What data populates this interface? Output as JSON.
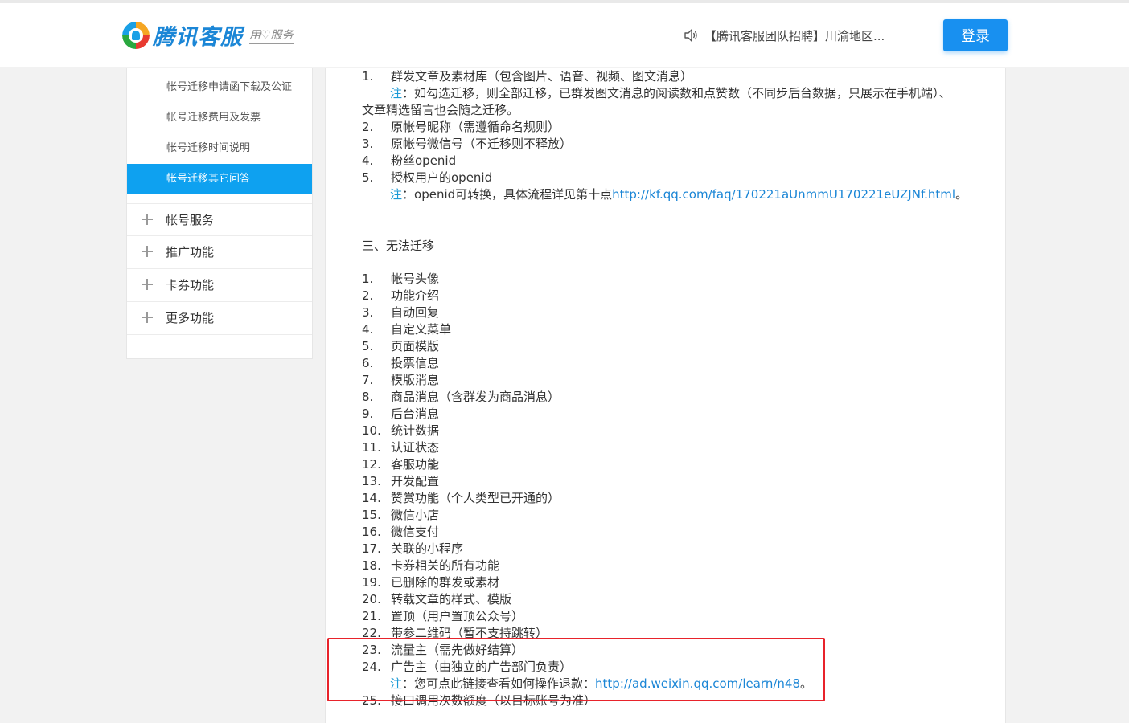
{
  "header": {
    "logo_text": "腾讯客服",
    "logo_slogan": "用♡服务",
    "notice": "【腾讯客服团队招聘】川渝地区...",
    "login_label": "登录"
  },
  "sidebar": {
    "sub_items": [
      {
        "label": "帐号迁移申请函下载及公证",
        "active": false
      },
      {
        "label": "帐号迁移费用及发票",
        "active": false
      },
      {
        "label": "帐号迁移时间说明",
        "active": false
      },
      {
        "label": "帐号迁移其它问答",
        "active": true
      }
    ],
    "categories": [
      {
        "label": "帐号服务"
      },
      {
        "label": "推广功能"
      },
      {
        "label": "卡券功能"
      },
      {
        "label": "更多功能"
      }
    ]
  },
  "content": {
    "migratable": [
      {
        "num": "1.",
        "text": "群发文章及素材库（包含图片、语音、视频、图文消息）"
      },
      {
        "num": "2.",
        "text": "原帐号昵称（需遵循命名规则）"
      },
      {
        "num": "3.",
        "text": "原帐号微信号（不迁移则不释放）"
      },
      {
        "num": "4.",
        "text": "粉丝openid"
      },
      {
        "num": "5.",
        "text": "授权用户的openid"
      }
    ],
    "note1_label": "注",
    "note1_line1": "：如勾选迁移，则全部迁移，已群发图文消息的阅读数和点赞数（不同步后台数据，只展示在手机端）、",
    "note1_line2": "文章精选留言也会随之迁移。",
    "note2_label": "注",
    "note2_text": "：openid可转换，具体流程详见第十点",
    "note2_link": "http://kf.qq.com/faq/170221aUnmmU170221eUZJNf.html",
    "note2_tail": "。",
    "section_title": "三、无法迁移",
    "non_migratable": [
      {
        "num": "1.",
        "text": "帐号头像"
      },
      {
        "num": "2.",
        "text": "功能介绍"
      },
      {
        "num": "3.",
        "text": "自动回复"
      },
      {
        "num": "4.",
        "text": "自定义菜单"
      },
      {
        "num": "5.",
        "text": "页面模版"
      },
      {
        "num": "6.",
        "text": "投票信息"
      },
      {
        "num": "7.",
        "text": "模版消息"
      },
      {
        "num": "8.",
        "text": "商品消息（含群发为商品消息）"
      },
      {
        "num": "9.",
        "text": "后台消息"
      },
      {
        "num": "10.",
        "text": "统计数据"
      },
      {
        "num": "11.",
        "text": "认证状态"
      },
      {
        "num": "12.",
        "text": "客服功能"
      },
      {
        "num": "13.",
        "text": "开发配置"
      },
      {
        "num": "14.",
        "text": "赞赏功能（个人类型已开通的）"
      },
      {
        "num": "15.",
        "text": "微信小店"
      },
      {
        "num": "16.",
        "text": "微信支付"
      },
      {
        "num": "17.",
        "text": "关联的小程序"
      },
      {
        "num": "18.",
        "text": "卡券相关的所有功能"
      },
      {
        "num": "19.",
        "text": "已删除的群发或素材"
      },
      {
        "num": "20.",
        "text": "转载文章的样式、模版"
      },
      {
        "num": "21.",
        "text": "置顶（用户置顶公众号）"
      },
      {
        "num": "22.",
        "text": "带参二维码（暂不支持跳转）"
      },
      {
        "num": "23.",
        "text": "流量主（需先做好结算）"
      },
      {
        "num": "24.",
        "text": "广告主（由独立的广告部门负责）"
      },
      {
        "num": "25.",
        "text": "接口调用次数额度（以目标账号为准）"
      }
    ],
    "note3_label": "注",
    "note3_text": "：您可点此链接查看如何操作退款：",
    "note3_link": "http://ad.weixin.qq.com/learn/n48",
    "note3_tail": "。"
  }
}
